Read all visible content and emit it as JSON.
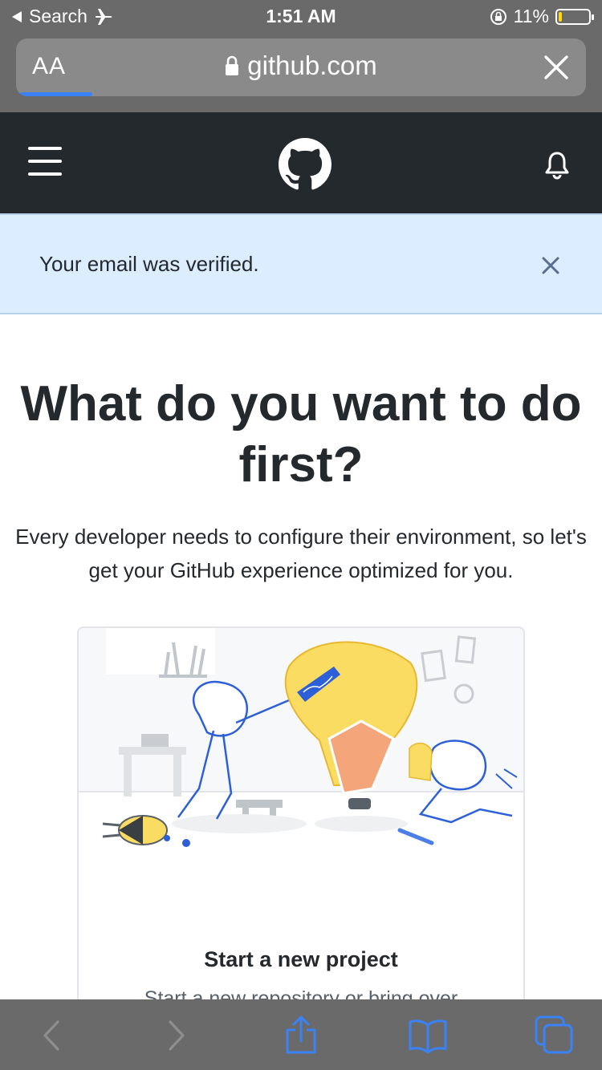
{
  "status_bar": {
    "back_app": "Search",
    "time": "1:51 AM",
    "battery_percent": "11%",
    "battery_level": 0.11
  },
  "url_bar": {
    "text_size_label": "AA",
    "domain": "github.com",
    "load_progress": 0.13
  },
  "flash": {
    "message": "Your email was verified."
  },
  "main": {
    "heading": "What do you want to do first?",
    "subheading": "Every developer needs to configure their environment, so let's get your GitHub experience optimized for you.",
    "card": {
      "title": "Start a new project",
      "description": "Start a new repository or bring over"
    }
  },
  "colors": {
    "header_bg": "#24292e",
    "flash_bg": "#dbedff",
    "safari_chrome": "#6a6a6a",
    "accent_blue": "#3b82f6",
    "battery_yellow": "#ffd60a"
  },
  "icons": {
    "back": "back-arrow-icon",
    "airplane": "airplane-icon",
    "lock": "lock-icon",
    "menu": "hamburger-icon",
    "logo": "github-octocat-icon",
    "notifications": "bell-icon",
    "dismiss": "close-icon",
    "share": "share-icon",
    "bookmarks": "book-icon",
    "tabs": "tabs-icon"
  }
}
